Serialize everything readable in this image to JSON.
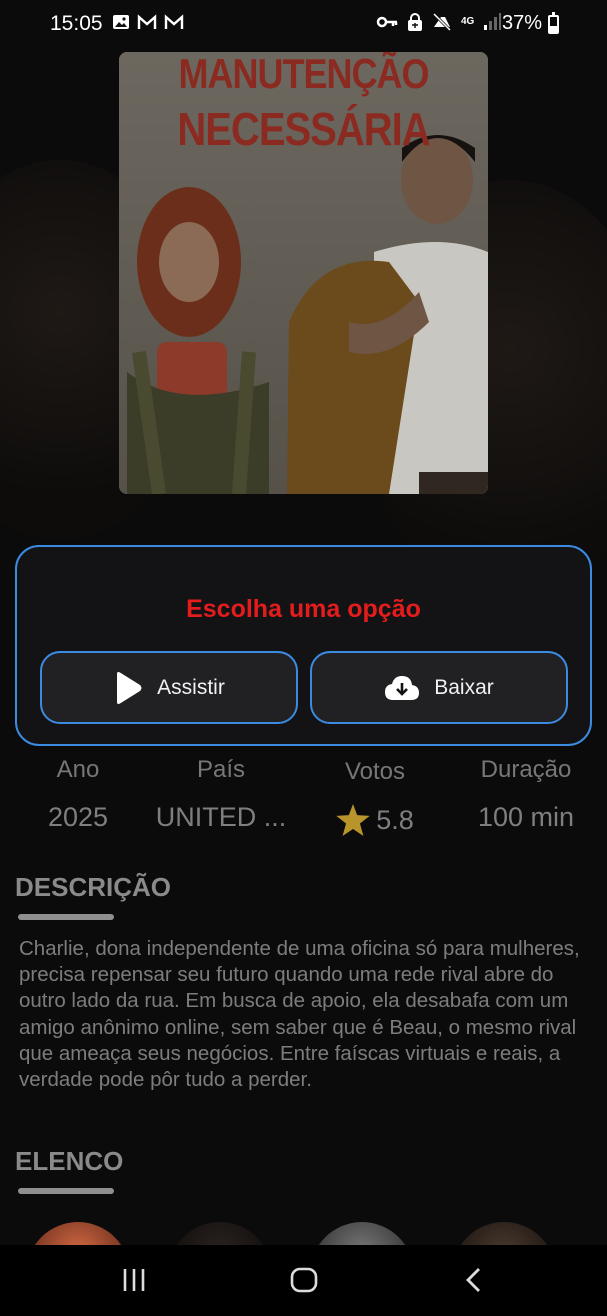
{
  "status_bar": {
    "time": "15:05",
    "battery": "37%",
    "network": "4G",
    "left_icons": [
      "image-icon",
      "gmail-icon",
      "gmail-icon"
    ],
    "right_icons": [
      "key-icon",
      "lock-icon",
      "mute-icon",
      "data-4g-icon",
      "signal-icon"
    ]
  },
  "poster": {
    "title_line1": "MANUTENÇÃO",
    "title_line2": "NECESSÁRIA"
  },
  "dialog": {
    "title": "Escolha uma opção",
    "watch_label": "Assistir",
    "download_label": "Baixar",
    "accent_color": "#3b8be0",
    "title_color": "#e31c1c"
  },
  "stats": {
    "year_label": "Ano",
    "year_value": "2025",
    "country_label": "País",
    "country_value": "UNITED ...",
    "votes_label": "Votos",
    "votes_value": "5.8",
    "duration_label": "Duração",
    "duration_value": "100 min",
    "star_color": "#b8942a"
  },
  "description": {
    "title": "DESCRIÇÃO",
    "text": "Charlie, dona independente de uma oficina só para mulheres, precisa repensar seu futuro quando uma rede rival abre do outro lado da rua. Em busca de apoio, ela desabafa com um amigo anônimo online, sem saber que é Beau, o mesmo rival que ameaça seus negócios. Entre faíscas virtuais e reais, a verdade pode pôr tudo a perder."
  },
  "cast": {
    "title": "ELENCO"
  },
  "nav": {
    "recents": "recents-icon",
    "home": "home-icon",
    "back": "back-icon"
  }
}
